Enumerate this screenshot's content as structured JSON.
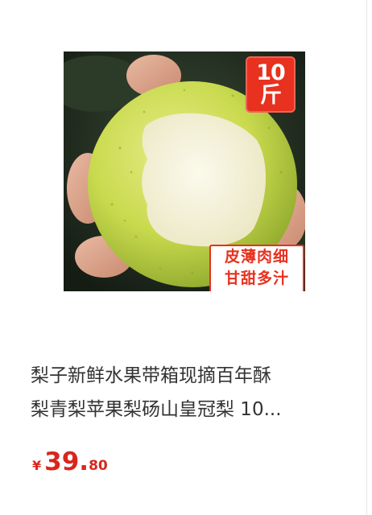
{
  "product": {
    "image_alt": "pear",
    "badge_weight": "10斤",
    "badge_claim_line1": "皮薄肉细",
    "badge_claim_line2": "甘甜多汁",
    "title_line1": "梨子新鲜水果带箱现摘百年酥",
    "title_line2": "梨青梨苹果梨砀山皇冠梨 10...",
    "price": {
      "symbol": "¥",
      "integer": "39.",
      "decimal": "80"
    }
  },
  "colors": {
    "price": "#d9261c",
    "badge_red": "#e8311f",
    "title_text": "#333333"
  }
}
